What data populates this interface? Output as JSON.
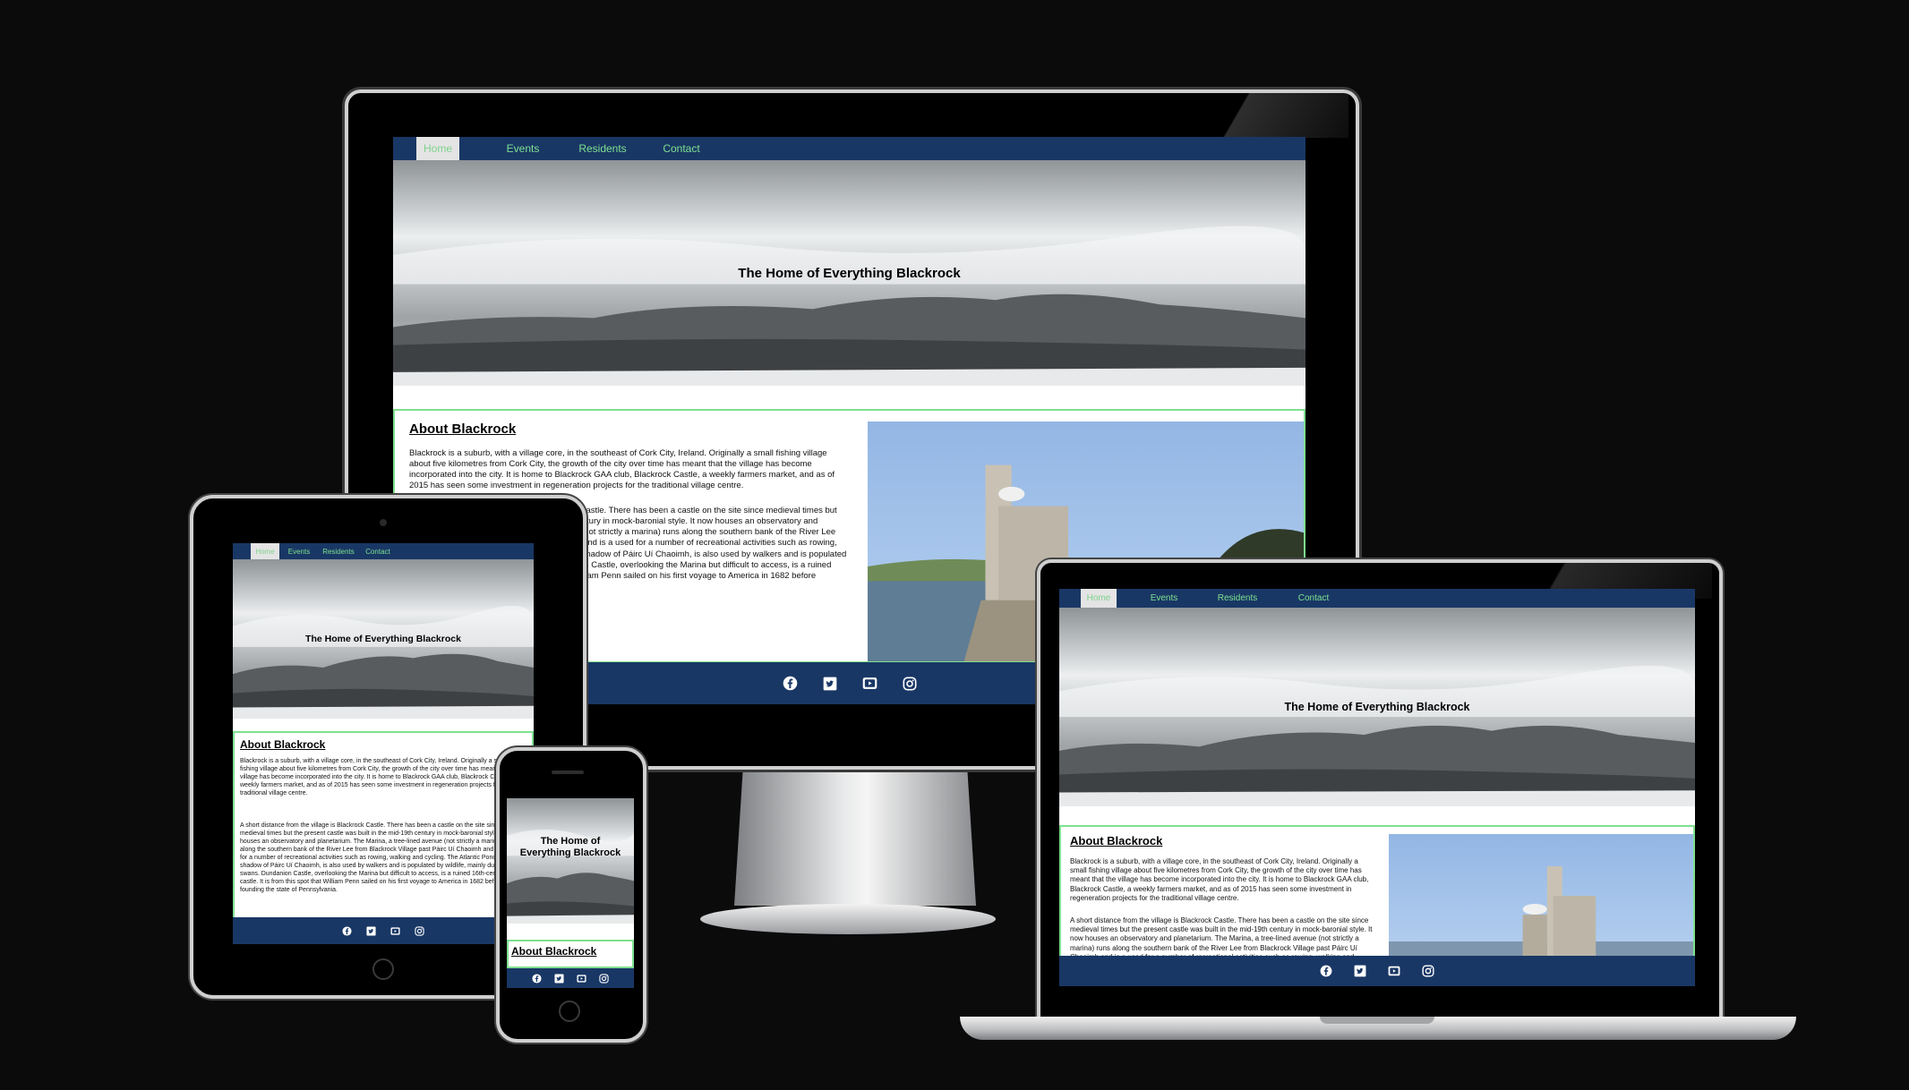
{
  "site": {
    "nav": [
      "Home",
      "Events",
      "Residents",
      "Contact"
    ],
    "active_nav": "Home",
    "hero_title": "The Home of Everything Blackrock",
    "about_heading": "About Blackrock",
    "paragraph1": "Blackrock is a suburb, with a village core, in the southeast of Cork City, Ireland. Originally a small fishing village about five kilometres from Cork City, the growth of the city over time has meant that the village has become incorporated into the city. It is home to Blackrock GAA club, Blackrock Castle, a weekly farmers market, and as of 2015 has seen some investment in regeneration projects for the traditional village centre.",
    "paragraph2": "A short distance from the village is Blackrock Castle. There has been a castle on the site since medieval times but the present castle was built in the mid-19th century in mock-baronial style. It now houses an observatory and planetarium. The Marina, a tree-lined avenue (not strictly a marina) runs along the southern bank of the River Lee from Blackrock Village past Páirc Uí Chaoimh and is a used for a number of recreational activities such as rowing, walking and cycling. The Atlantic Pond, in the shadow of Páirc Uí Chaoimh, is also used by walkers and is populated by wildlife, mainly ducks and swans. Dundanion Castle, overlooking the Marina but difficult to access, is a ruined 16th-century castle. It is from this spot that William Penn sailed on his first voyage to America in 1682 before founding the state of Pennsylvania.",
    "social_icons": [
      "facebook-icon",
      "twitter-icon",
      "youtube-icon",
      "instagram-icon"
    ]
  },
  "colors": {
    "nav_bg": "#193765",
    "nav_text": "#7ee08f",
    "active_bg": "#e4e4e4",
    "border_accent": "#7ee08f",
    "background": "#0b0b0c"
  }
}
